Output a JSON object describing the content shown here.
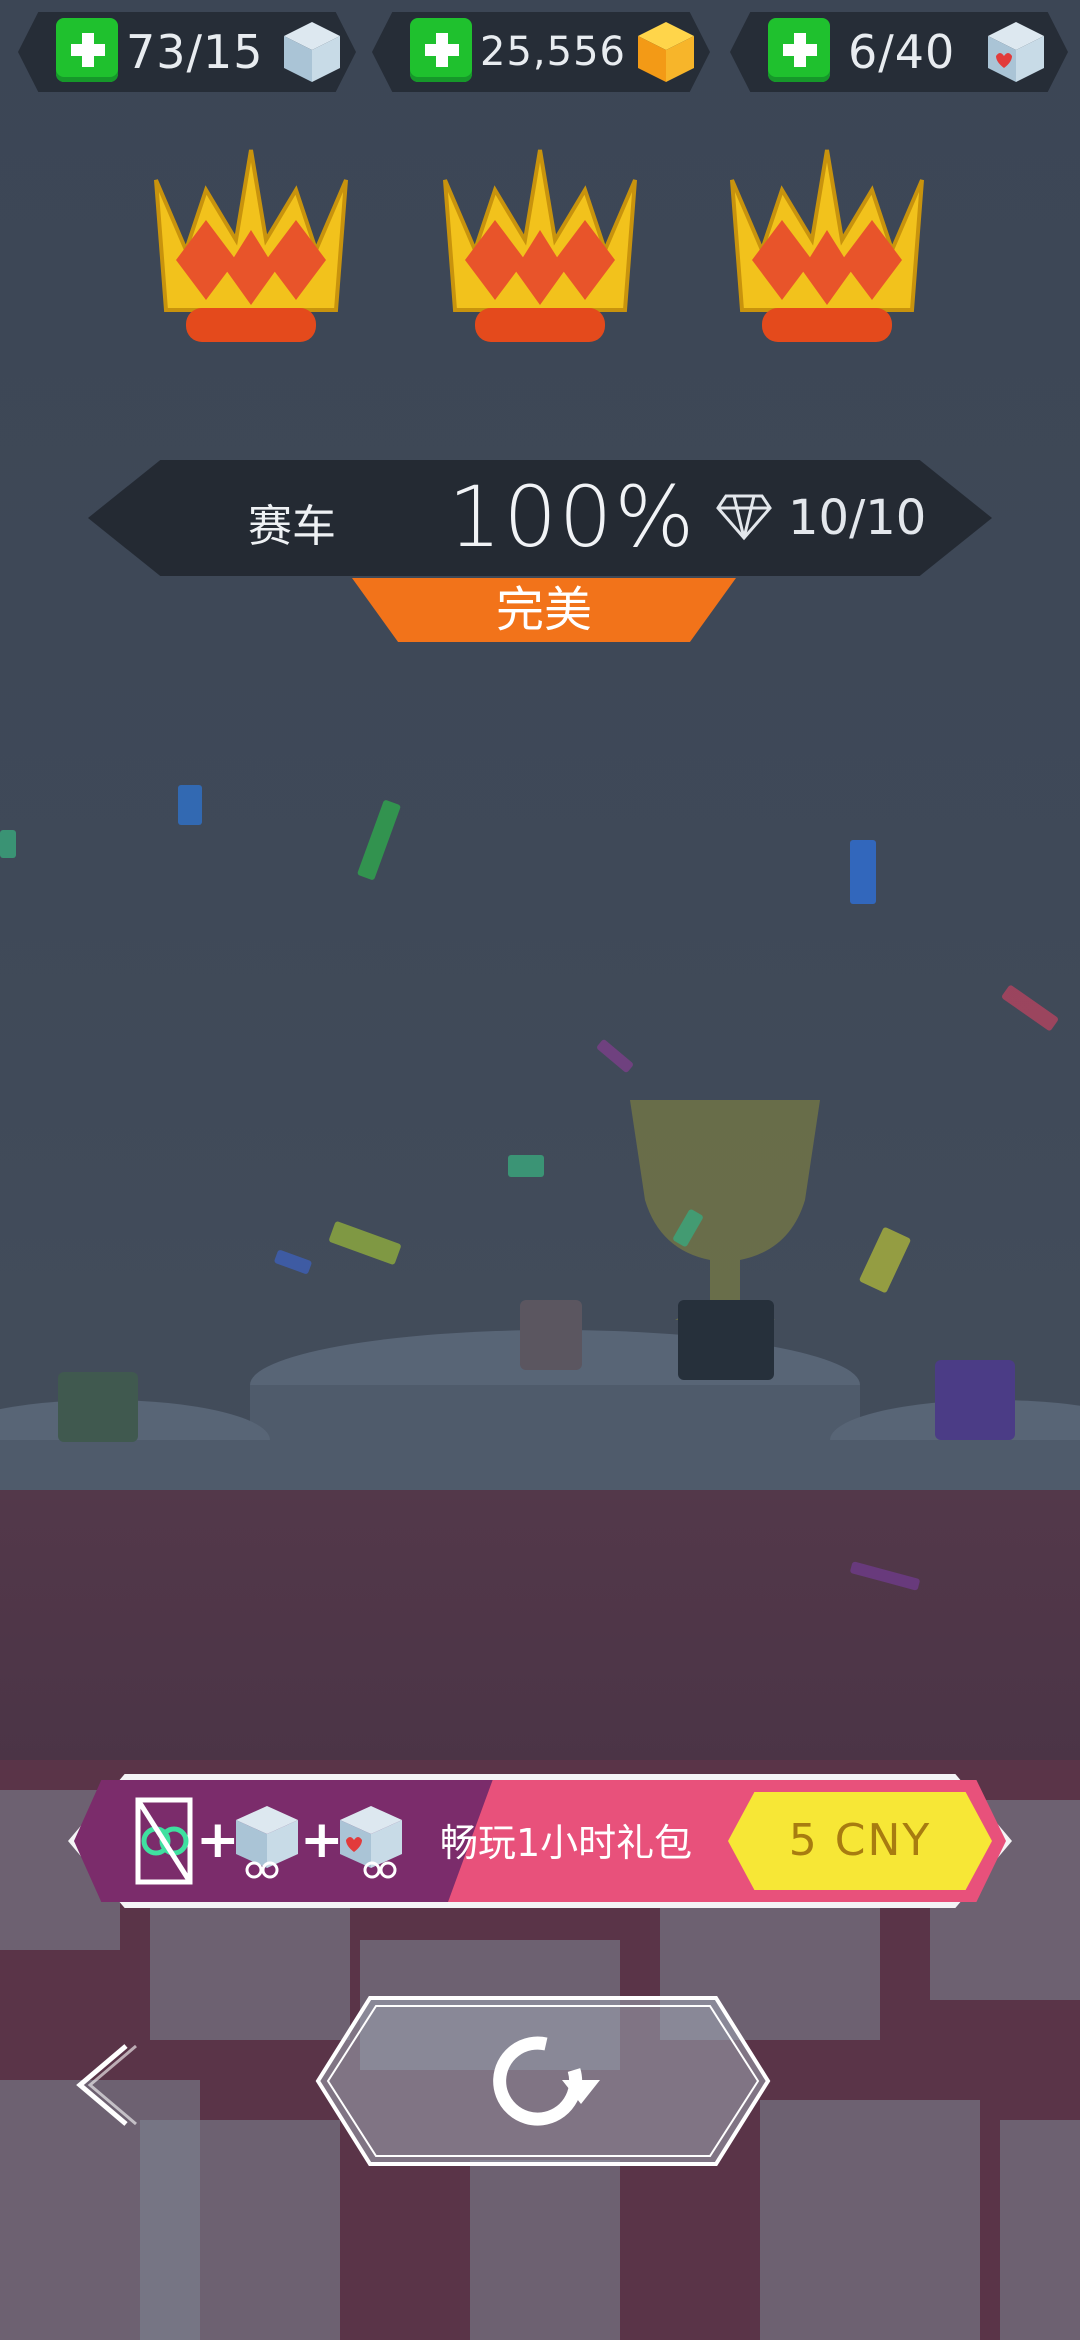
{
  "resources": [
    {
      "value": "73/15",
      "icon": "ice-cube-icon"
    },
    {
      "value": "25,556",
      "icon": "gold-cube-icon"
    },
    {
      "value": "6/40",
      "icon": "heart-cube-icon"
    }
  ],
  "crowns": {
    "count": 3
  },
  "result": {
    "level_name": "赛车",
    "percent": "100%",
    "gems": "10/10",
    "rating": "完美"
  },
  "offer": {
    "label": "畅玩1小时礼包",
    "price": "5 CNY",
    "plus": "+",
    "icons": [
      "no-ads-icon",
      "ice-cube-icon",
      "heart-cube-icon"
    ]
  },
  "controls": {
    "back_icon": "chevron-left-icon",
    "replay_icon": "replay-icon"
  },
  "colors": {
    "accent_orange": "#f2731a",
    "plus_green": "#1fc12e",
    "offer_pink": "#e8517b",
    "offer_purple": "#7b2c6b",
    "price_yellow": "#f7e736"
  }
}
